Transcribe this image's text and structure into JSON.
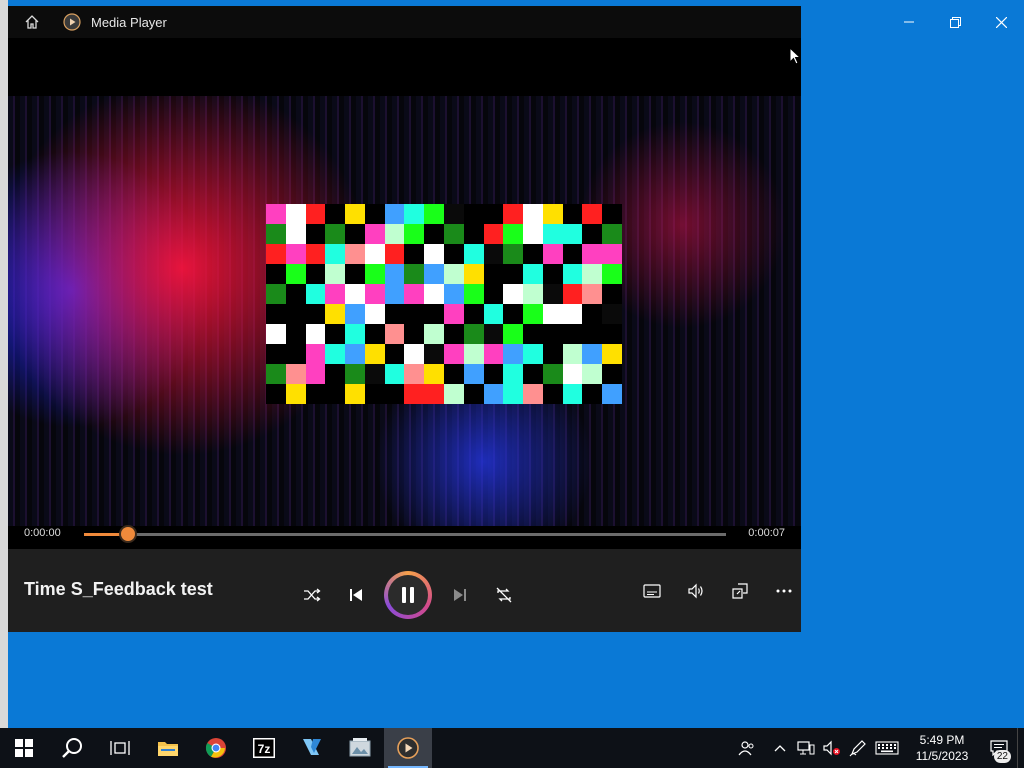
{
  "window": {
    "app_title": "Media Player"
  },
  "player": {
    "time_elapsed": "0:00:00",
    "time_total": "0:00:07",
    "progress": 0.068,
    "track_title": "Time S_Feedback test",
    "accent_color": "#f08a3b"
  },
  "controls": {
    "shuffle_icon": "shuffle-icon",
    "previous_icon": "previous-icon",
    "play_pause_state": "pause",
    "next_icon": "next-icon",
    "repeat_icon": "repeat-off-icon",
    "captions_icon": "captions-icon",
    "volume_icon": "volume-icon",
    "miniplayer_icon": "miniplayer-icon",
    "more_icon": "more-icon"
  },
  "taskbar": {
    "apps": [
      "start",
      "search",
      "task-view",
      "file-explorer",
      "chrome",
      "7zip",
      "visual-studio",
      "image-viewer",
      "media-player"
    ],
    "clock_time": "5:49 PM",
    "clock_date": "11/5/2023",
    "notification_count": "22"
  }
}
